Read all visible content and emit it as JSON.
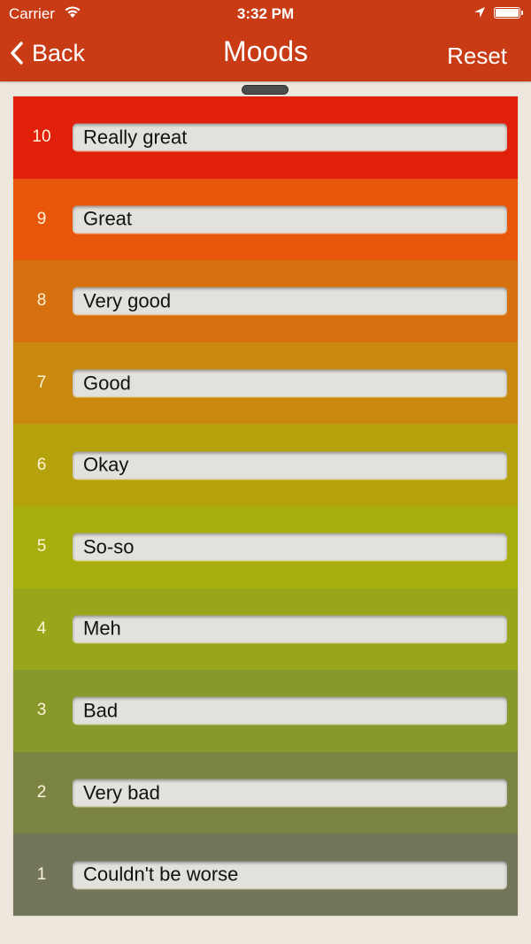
{
  "status_bar": {
    "carrier": "Carrier",
    "time": "3:32 PM",
    "icons": [
      "wifi-icon",
      "location-arrow-icon",
      "battery-icon"
    ]
  },
  "nav": {
    "back_label": "Back",
    "back_icon": "chevron-left-icon",
    "title": "Moods",
    "reset_label": "Reset"
  },
  "moods": [
    {
      "value": "10",
      "label": "Really great",
      "color": "#e0200a"
    },
    {
      "value": "9",
      "label": "Great",
      "color": "#e8560c"
    },
    {
      "value": "8",
      "label": "Very good",
      "color": "#d7700f"
    },
    {
      "value": "7",
      "label": "Good",
      "color": "#c8890e"
    },
    {
      "value": "6",
      "label": "Okay",
      "color": "#b6a20c"
    },
    {
      "value": "5",
      "label": "So-so",
      "color": "#a6ad0c"
    },
    {
      "value": "4",
      "label": "Meh",
      "color": "#97a61a"
    },
    {
      "value": "3",
      "label": "Bad",
      "color": "#88992b"
    },
    {
      "value": "2",
      "label": "Very bad",
      "color": "#7c8444"
    },
    {
      "value": "1",
      "label": "Couldn't be worse",
      "color": "#73765b"
    }
  ]
}
